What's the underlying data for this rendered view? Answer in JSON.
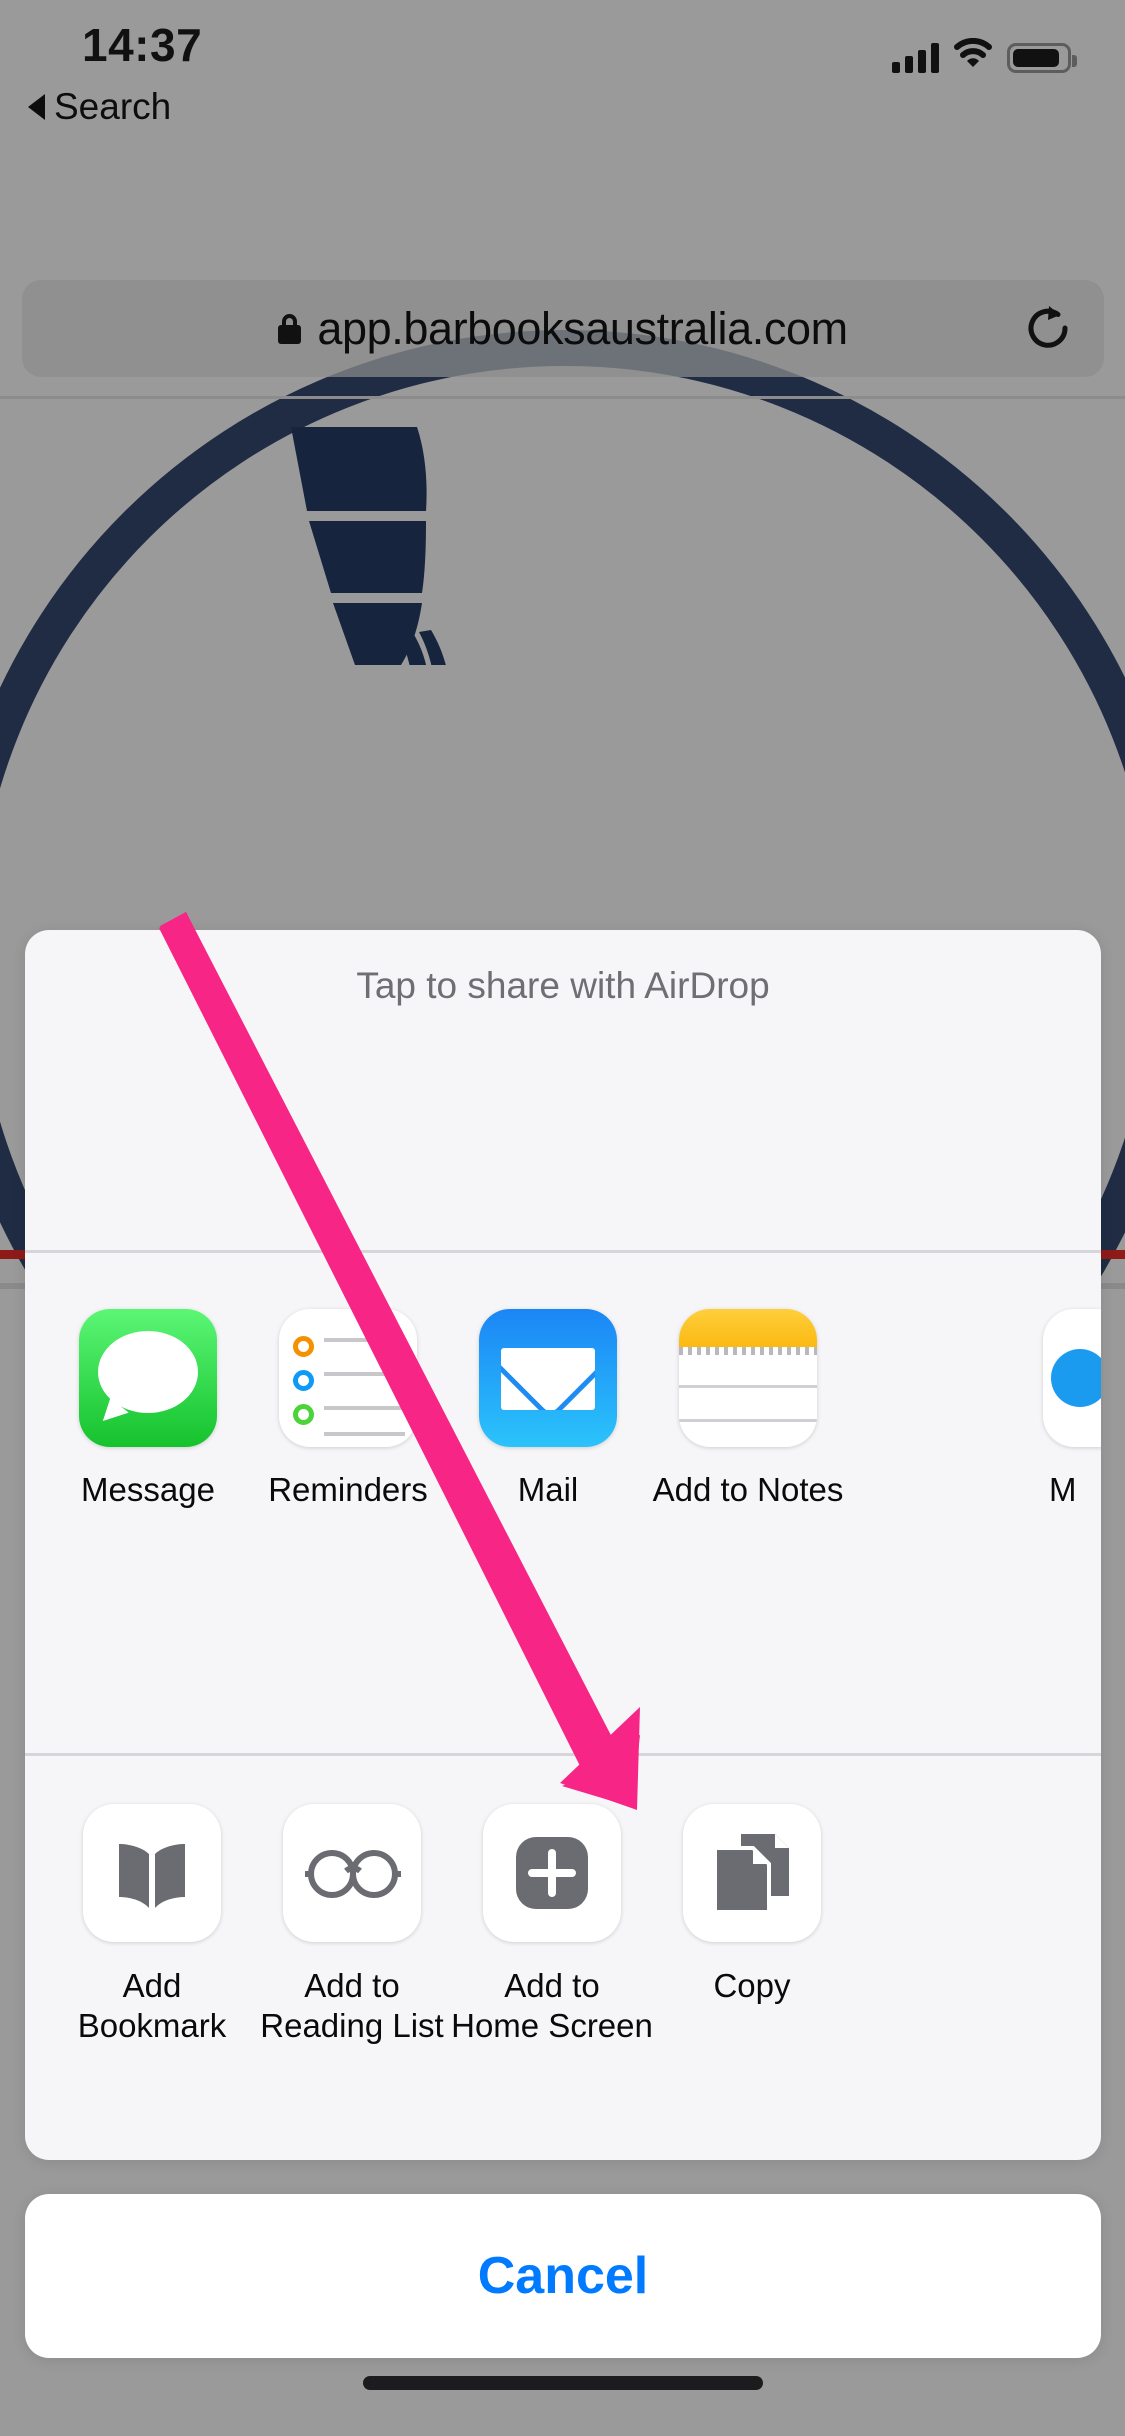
{
  "status_bar": {
    "time": "14:37",
    "signal_icon": "cellular-bars-icon",
    "wifi_icon": "wifi-icon",
    "battery_icon": "battery-icon"
  },
  "safari": {
    "back_label": "Search",
    "back_icon": "back-triangle-icon",
    "url": "app.barbooksaustralia.com",
    "lock_icon": "lock-icon",
    "reload_icon": "reload-icon"
  },
  "share_sheet": {
    "airdrop_header": "Tap to share with AirDrop",
    "apps": [
      {
        "label": "Message",
        "icon": "messages-app-icon"
      },
      {
        "label": "Reminders",
        "icon": "reminders-app-icon"
      },
      {
        "label": "Mail",
        "icon": "mail-app-icon"
      },
      {
        "label": "Add to Notes",
        "icon": "notes-app-icon"
      }
    ],
    "app_partial": {
      "label": "M",
      "icon": "partial-app-icon"
    },
    "actions": [
      {
        "label": "Add\nBookmark",
        "label_line1": "Add",
        "label_line2": "Bookmark",
        "icon": "book-icon"
      },
      {
        "label": "Add to\nReading List",
        "label_line1": "Add to",
        "label_line2": "Reading List",
        "icon": "glasses-icon"
      },
      {
        "label": "Add to\nHome Screen",
        "label_line1": "Add to",
        "label_line2": "Home Screen",
        "icon": "plus-square-icon"
      },
      {
        "label": "Copy",
        "label_line1": "Copy",
        "label_line2": "",
        "icon": "copy-documents-icon"
      }
    ],
    "cancel_label": "Cancel"
  },
  "annotation": {
    "arrow_icon": "pink-arrow-icon",
    "arrow_color": "#F72585",
    "points_to": "Add to Home Screen"
  },
  "colors": {
    "accent_blue": "#007AFF",
    "brand_navy": "#16243D",
    "annotation_pink": "#F72585",
    "sheet_background": "#F6F6F8",
    "dimmed_backdrop": "#9A9A9A"
  },
  "home_indicator": "home-indicator-bar"
}
